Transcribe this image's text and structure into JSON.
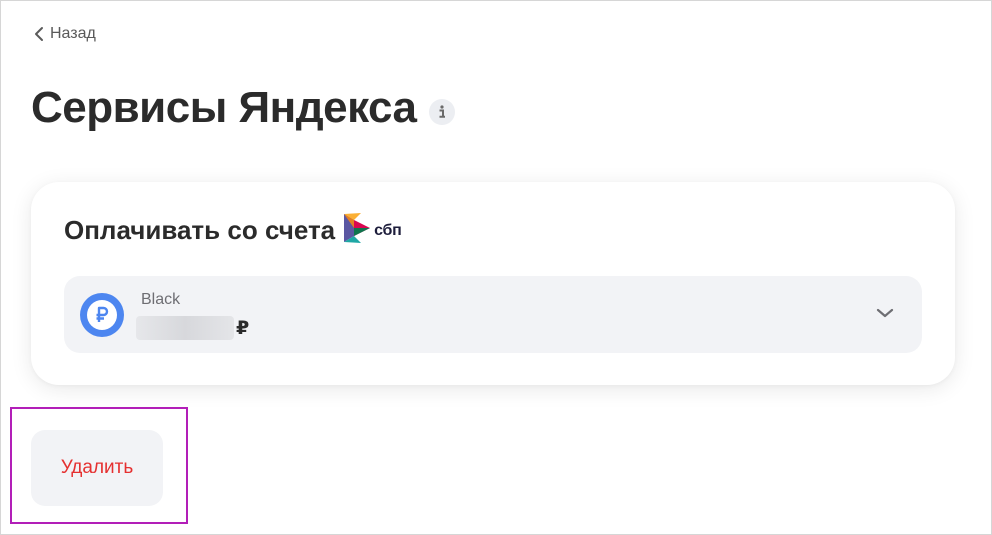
{
  "nav": {
    "back_label": "Назад"
  },
  "page": {
    "title": "Сервисы Яндекса"
  },
  "card": {
    "title": "Оплачивать со счета",
    "sbp_label": "сбп",
    "account": {
      "name": "Black",
      "currency_sign": "₽"
    }
  },
  "actions": {
    "delete_label": "Удалить"
  },
  "colors": {
    "delete_text": "#e53030",
    "coin_blue": "#4d86f0",
    "highlight": "#b21eb8",
    "card_fill": "#f2f3f6"
  },
  "icons": [
    "chevron-left-icon",
    "info-icon",
    "sbp-logo-icon",
    "ruble-coin-icon",
    "chevron-down-icon"
  ]
}
